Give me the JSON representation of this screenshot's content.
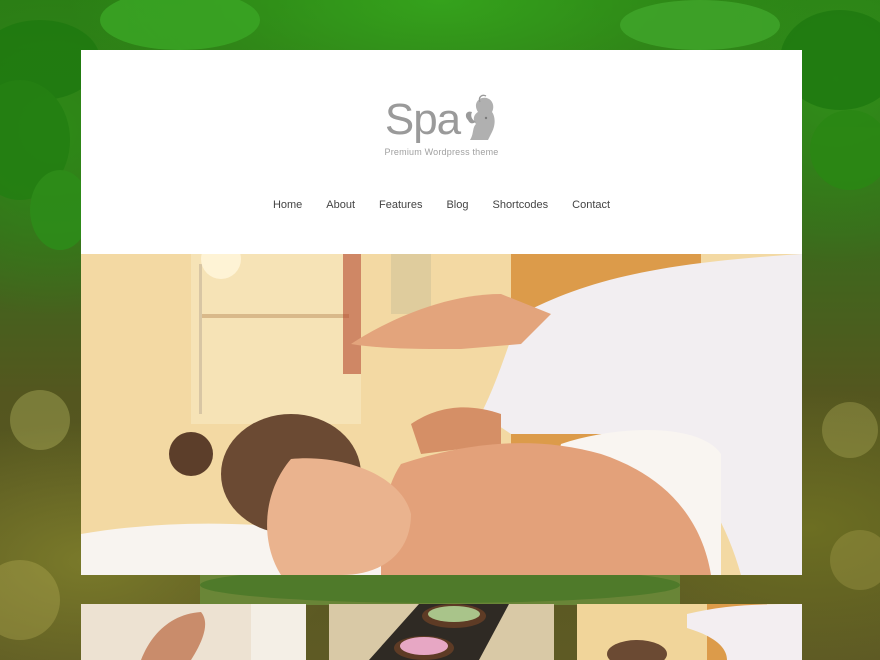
{
  "site": {
    "logo_word": "Spa",
    "tagline": "Premium Wordpress theme"
  },
  "nav": {
    "items": [
      {
        "label": "Home"
      },
      {
        "label": "About"
      },
      {
        "label": "Features"
      },
      {
        "label": "Blog"
      },
      {
        "label": "Shortcodes"
      },
      {
        "label": "Contact"
      }
    ]
  },
  "colors": {
    "header_bg": "#ffffff",
    "logo_gray": "#9a9a9a",
    "nav_text": "#444444"
  }
}
